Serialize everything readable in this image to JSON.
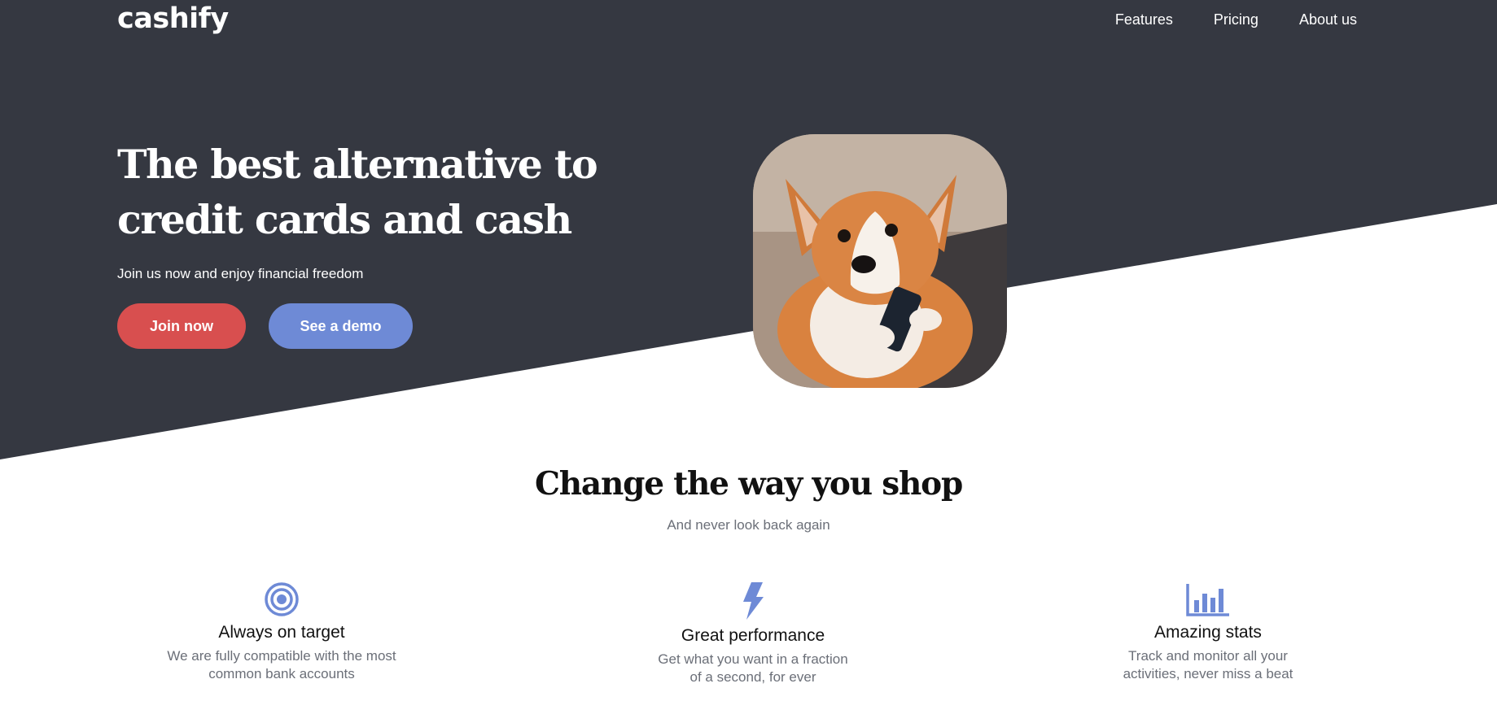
{
  "brand": {
    "logo": "cashify"
  },
  "nav": {
    "items": [
      "Features",
      "Pricing",
      "About us"
    ]
  },
  "hero": {
    "title": "The best alternative to credit cards and cash",
    "subtitle": "Join us now and enjoy financial freedom",
    "primary_button": "Join now",
    "secondary_button": "See a demo",
    "image_icon": "corgi-with-phone-image"
  },
  "section": {
    "title": "Change the way you shop",
    "subtitle": "And never look back again"
  },
  "features": [
    {
      "icon": "target-icon",
      "title": "Always on target",
      "line1": "We are fully compatible with the most",
      "line2": "common bank accounts"
    },
    {
      "icon": "lightning-icon",
      "title": "Great performance",
      "line1": "Get what you want in a fraction",
      "line2": "of a second, for ever"
    },
    {
      "icon": "bar-chart-icon",
      "title": "Amazing stats",
      "line1": "Track and monitor all your",
      "line2": "activities, never miss a beat"
    }
  ],
  "colors": {
    "hero_bg": "#353841",
    "primary": "#d84f4f",
    "secondary": "#6e8ad6",
    "icon": "#6e8ad6",
    "muted_text": "#6b6f78"
  }
}
